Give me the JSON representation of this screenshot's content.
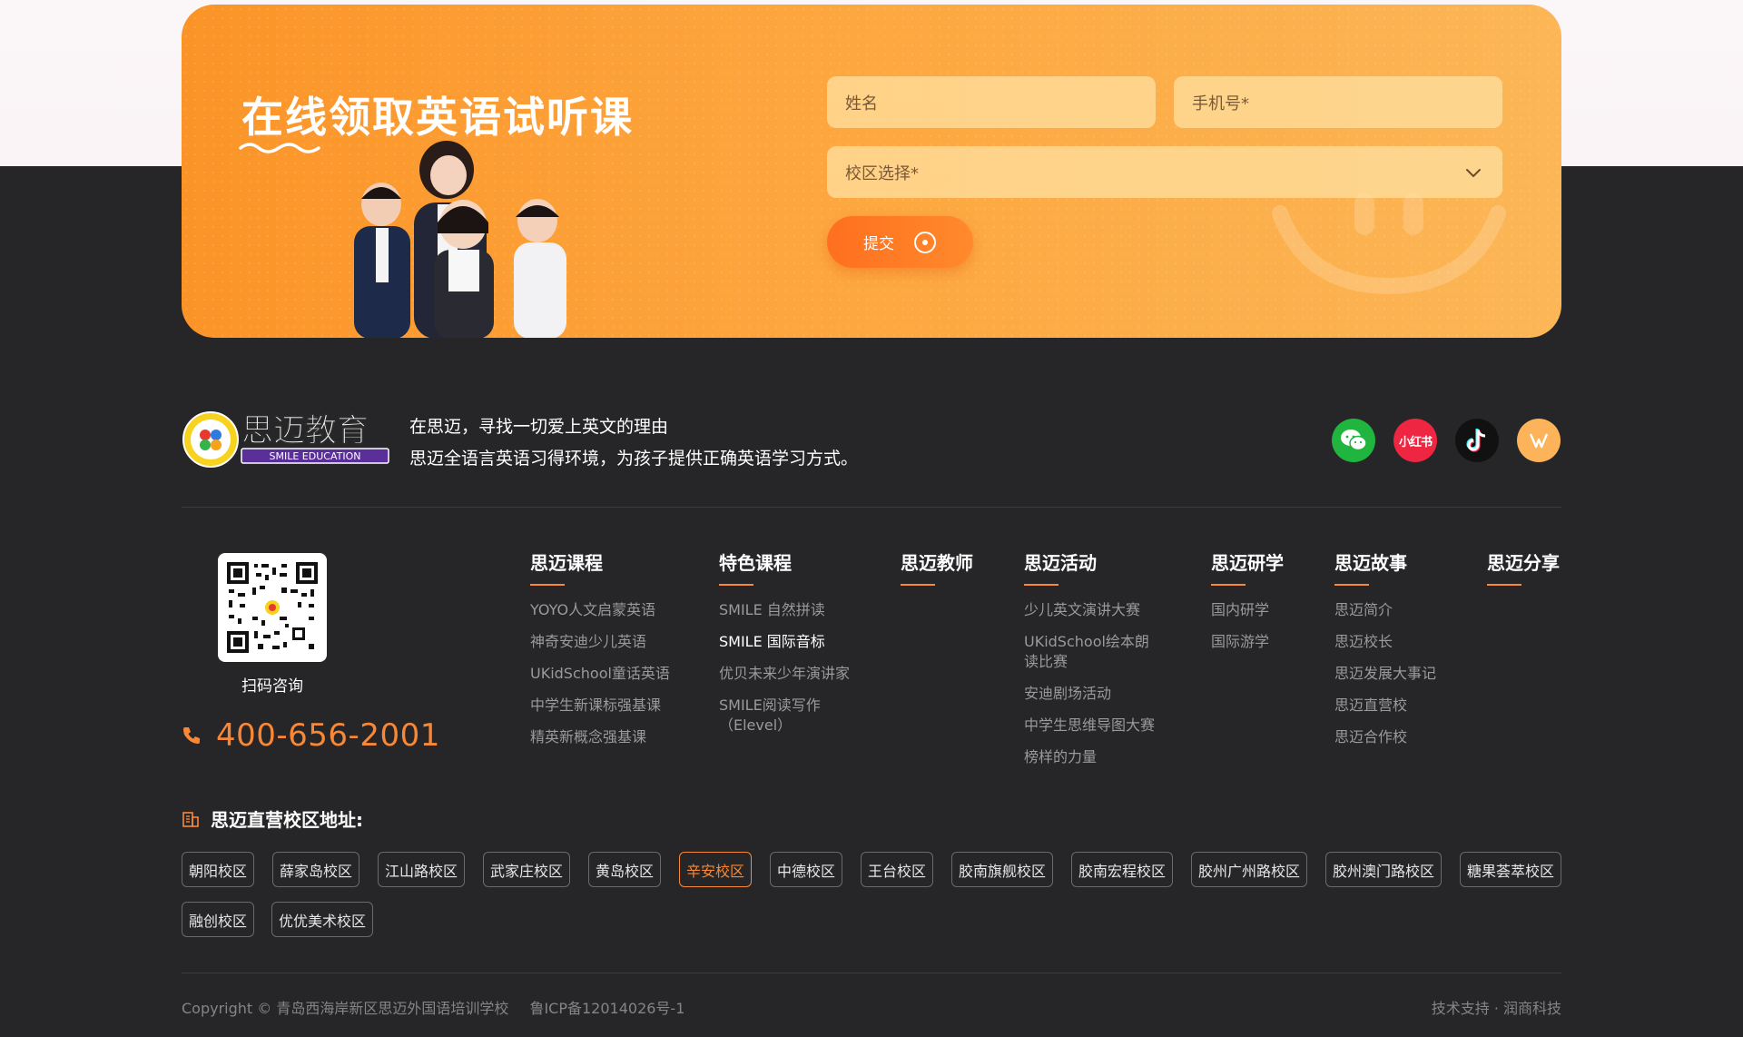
{
  "banner": {
    "title": "在线领取英语试听课",
    "form": {
      "name_placeholder": "姓名",
      "phone_placeholder": "手机号*",
      "campus_placeholder": "校区选择*",
      "submit_label": "提交"
    }
  },
  "brand": {
    "logo_text": "思迈教育",
    "logo_subtext": "SMILE EDUCATION",
    "slogan_line1": "在思迈，寻找一切爱上英文的理由",
    "slogan_line2": "思迈全语言英语习得环境，为孩子提供正确英语学习方式。",
    "socials": [
      {
        "name": "wechat-icon",
        "color": "#1fb53f"
      },
      {
        "name": "xiaohongshu-icon",
        "label": "小红书",
        "color": "#ee2641"
      },
      {
        "name": "douyin-icon",
        "color": "#111111"
      },
      {
        "name": "app-icon",
        "color": "#fcb35a"
      }
    ]
  },
  "contact": {
    "qr_label": "扫码咨询",
    "phone": "400-656-2001"
  },
  "nav": [
    {
      "title": "思迈课程",
      "links": [
        "YOYO人文启蒙英语",
        "神奇安迪少儿英语",
        "UKidSchool童话英语",
        "中学生新课标强基课",
        "精英新概念强基课"
      ]
    },
    {
      "title": "特色课程",
      "links": [
        "SMILE 自然拼读",
        "SMILE 国际音标",
        "优贝未来少年演讲家",
        "SMILE阅读写作（Elevel）"
      ]
    },
    {
      "title": "思迈教师",
      "links": []
    },
    {
      "title": "思迈活动",
      "links": [
        "少儿英文演讲大赛",
        "UKidSchool绘本朗读比赛",
        "安迪剧场活动",
        "中学生思维导图大赛",
        "榜样的力量"
      ]
    },
    {
      "title": "思迈研学",
      "links": [
        "国内研学",
        "国际游学"
      ]
    },
    {
      "title": "思迈故事",
      "links": [
        "思迈简介",
        "思迈校长",
        "思迈发展大事记",
        "思迈直营校",
        "思迈合作校"
      ]
    },
    {
      "title": "思迈分享",
      "links": []
    }
  ],
  "campuses": {
    "heading": "思迈直营校区地址:",
    "items": [
      "朝阳校区",
      "薛家岛校区",
      "江山路校区",
      "武家庄校区",
      "黄岛校区",
      "辛安校区",
      "中德校区",
      "王台校区",
      "胶南旗舰校区",
      "胶南宏程校区",
      "胶州广州路校区",
      "胶州澳门路校区",
      "糖果荟萃校区",
      "融创校区",
      "优优美术校区"
    ],
    "active": "辛安校区"
  },
  "footer": {
    "copyright": "Copyright © 青岛西海岸新区思迈外国语培训学校",
    "icp": "鲁ICP备12014026号-1",
    "support": "技术支持 · 润商科技"
  },
  "colors": {
    "accent": "#f98836",
    "banner": "#fda63e",
    "background": "#262527"
  }
}
